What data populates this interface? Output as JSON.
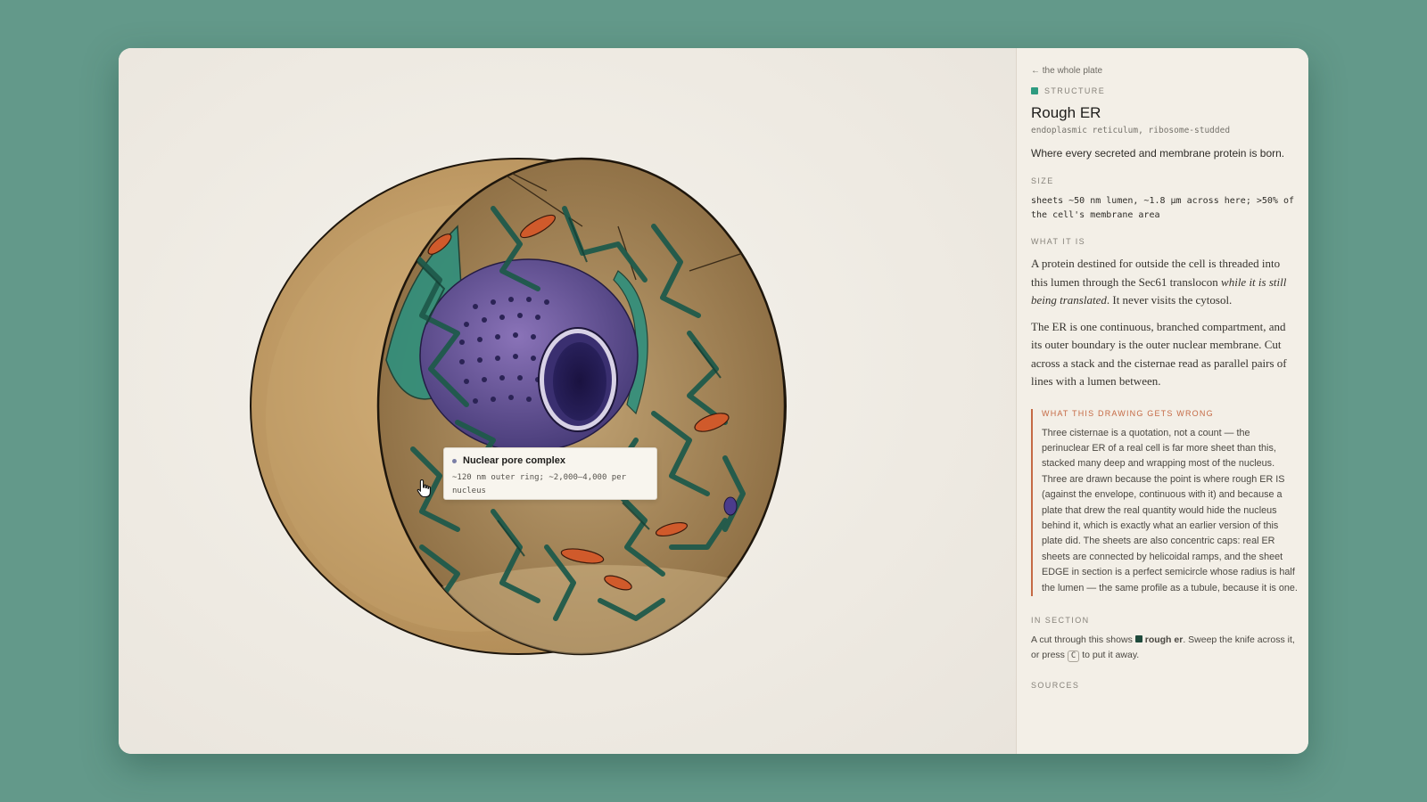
{
  "panel": {
    "back_link": "← the whole plate",
    "category": "STRUCTURE",
    "category_color": "#2e9b80",
    "title": "Rough ER",
    "subtitle": "endoplasmic reticulum, ribosome-studded",
    "summary": "Where every secreted and membrane protein is born.",
    "size_label": "SIZE",
    "size_text": "sheets ~50 nm lumen, ~1.8 µm across here; >50% of the cell's membrane area",
    "what_label": "WHAT IT IS",
    "what_p1_a": "A protein destined for outside the cell is threaded into this lumen through the Sec61 translocon ",
    "what_p1_em": "while it is still being translated",
    "what_p1_b": ". It never visits the cytosol.",
    "what_p2": "The ER is one continuous, branched compartment, and its outer boundary is the outer nuclear membrane. Cut across a stack and the cisternae read as parallel pairs of lines with a lumen between.",
    "wrong_label": "WHAT THIS DRAWING GETS WRONG",
    "wrong_color": "#c56a45",
    "wrong_text": "Three cisternae is a quotation, not a count — the perinuclear ER of a real cell is far more sheet than this, stacked many deep and wrapping most of the nucleus. Three are drawn because the point is where rough ER IS (against the envelope, continuous with it) and because a plate that drew the real quantity would hide the nucleus behind it, which is exactly what an earlier version of this plate did. The sheets are also concentric caps: real ER sheets are connected by helicoidal ramps, and the sheet EDGE in section is a perfect semicircle whose radius is half the lumen — the same profile as a tubule, because it is one.",
    "section_label": "IN SECTION",
    "section_pre": "A cut through this shows ",
    "section_bold": "rough er",
    "section_mid": ". Sweep the knife across it, or press ",
    "section_key": "C",
    "section_post": " to put it away.",
    "sources_label": "SOURCES"
  },
  "tooltip": {
    "title": "Nuclear pore complex",
    "body": "~120 nm outer ring; ~2,000–4,000 per nucleus"
  }
}
